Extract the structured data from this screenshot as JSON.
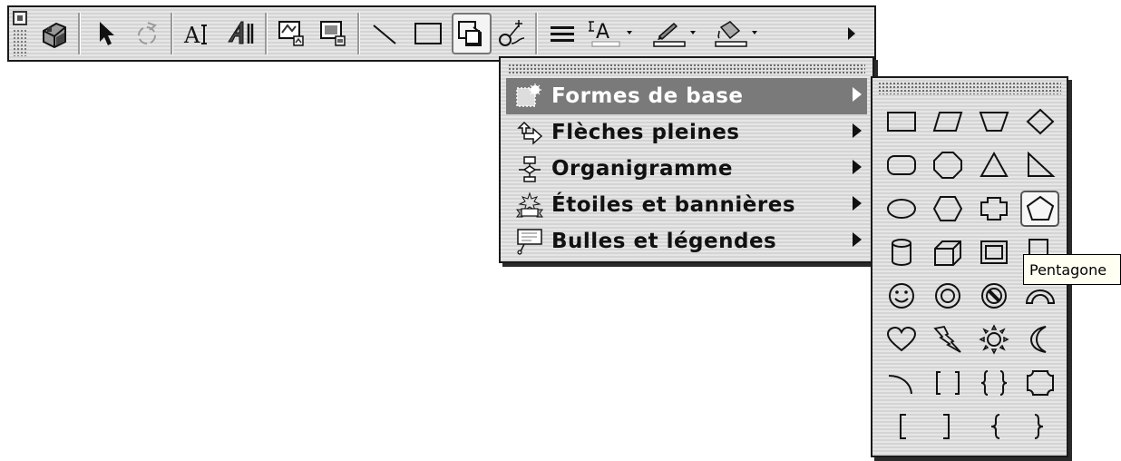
{
  "toolbar": {
    "buttons": [
      {
        "name": "3d-object-icon"
      },
      {
        "name": "select-arrow-icon"
      },
      {
        "name": "free-rotate-icon"
      },
      {
        "name": "text-box-icon"
      },
      {
        "name": "wordart-icon"
      },
      {
        "name": "insert-clipart-icon"
      },
      {
        "name": "insert-picture-icon"
      },
      {
        "name": "line-icon"
      },
      {
        "name": "rectangle-icon"
      },
      {
        "name": "autoshapes-icon"
      },
      {
        "name": "connectors-icon"
      },
      {
        "name": "line-style-icon"
      },
      {
        "name": "font-color-icon"
      },
      {
        "name": "line-color-icon"
      },
      {
        "name": "fill-color-icon"
      }
    ],
    "font_color_sample": "A"
  },
  "menu": {
    "items": [
      {
        "label": "Formes de base",
        "icon": "basic-shapes-icon",
        "selected": true
      },
      {
        "label": "Flèches pleines",
        "icon": "block-arrows-icon",
        "selected": false
      },
      {
        "label": "Organigramme",
        "icon": "flowchart-icon",
        "selected": false
      },
      {
        "label": "Étoiles et bannières",
        "icon": "stars-banners-icon",
        "selected": false
      },
      {
        "label": "Bulles et légendes",
        "icon": "callouts-icon",
        "selected": false
      }
    ]
  },
  "palette": {
    "shapes": [
      "rectangle",
      "parallelogram",
      "trapezoid",
      "diamond",
      "rounded-rectangle",
      "octagon",
      "triangle",
      "right-triangle",
      "oval",
      "hexagon",
      "cross",
      "pentagon",
      "can",
      "cube",
      "bevel",
      "folded-corner",
      "smiley-face",
      "donut",
      "no-symbol",
      "block-arc",
      "heart",
      "lightning-bolt",
      "sun",
      "moon",
      "arc",
      "double-bracket",
      "double-brace",
      "plaque",
      "left-bracket",
      "right-bracket",
      "left-brace",
      "right-brace"
    ],
    "hovered_shape": "pentagon"
  },
  "tooltip": {
    "text": "Pentagone"
  }
}
